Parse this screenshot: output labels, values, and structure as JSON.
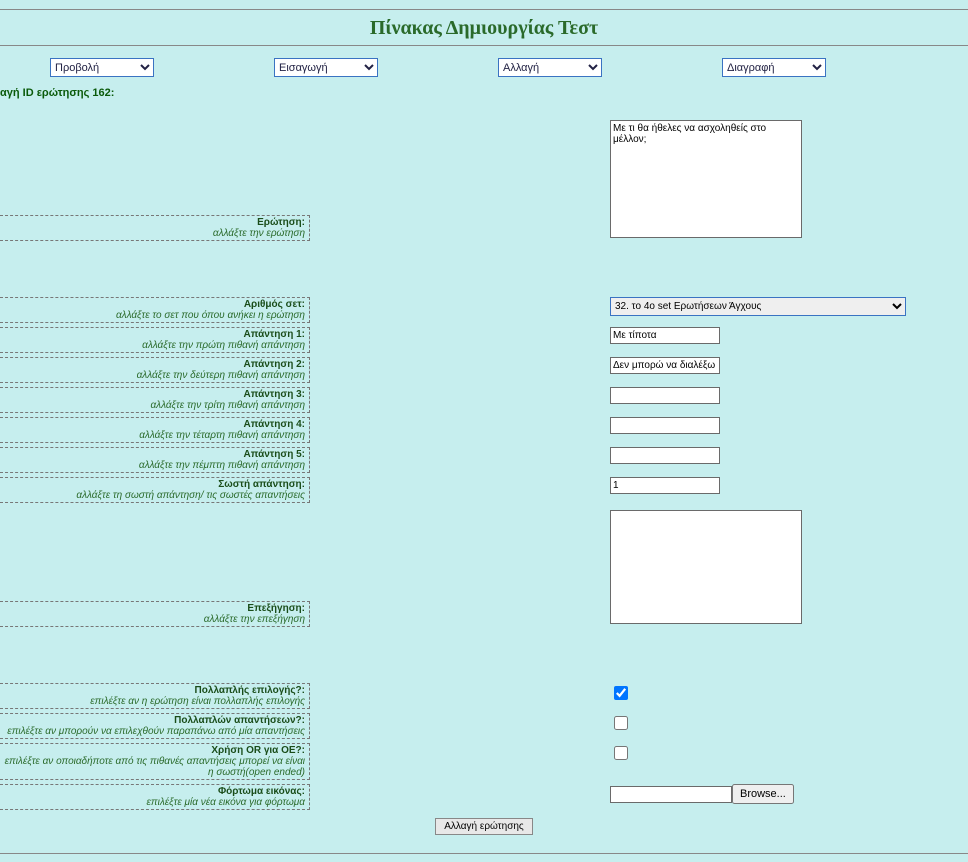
{
  "title": "Πίνακας Δημιουργίας Τεστ",
  "toolbar": {
    "view": "Προβολή",
    "insert": "Εισαγωγή",
    "change": "Αλλαγή",
    "delete": "Διαγραφή"
  },
  "status": "αγή ID ερώτησης 162:",
  "labels": {
    "question": "Ερώτηση:",
    "question_hint": "αλλάξτε την ερώτηση",
    "set_num": "Αριθμός σετ:",
    "set_num_hint": "αλλάξτε το σετ που όπου ανήκει η ερώτηση",
    "ans1": "Απάντηση 1:",
    "ans1_hint": "αλλάξτε την πρώτη πιθανή απάντηση",
    "ans2": "Απάντηση 2:",
    "ans2_hint": "αλλάξτε την δεύτερη πιθανή απάντηση",
    "ans3": "Απάντηση 3:",
    "ans3_hint": "αλλάξτε την τρίτη πιθανή απάντηση",
    "ans4": "Απάντηση 4:",
    "ans4_hint": "αλλάξτε την τέταρτη πιθανή απάντηση",
    "ans5": "Απάντηση 5:",
    "ans5_hint": "αλλάξτε την πέμπτη πιθανή απάντηση",
    "correct": "Σωστή απάντηση:",
    "correct_hint": "αλλάξτε τη σωστή απάντηση/ τις σωστές απαντήσεις",
    "explain": "Επεξήγηση:",
    "explain_hint": "αλλάξτε την επεξήγηση",
    "multi_choice": "Πολλαπλής επιλογής?:",
    "multi_choice_hint": "επιλέξτε αν η ερώτηση είναι πολλαπλής επιλογής",
    "multi_ans": "Πολλαπλών απαντήσεων?:",
    "multi_ans_hint": "επιλέξτε αν μπορούν να επιλεχθούν παραπάνω από μία απαντήσεις",
    "use_or": "Χρήση OR για ΟΕ?:",
    "use_or_hint": "επιλέξτε αν οποιαδήποτε από τις πιθανές απαντήσεις μπορεί να είναι η σωστή(open ended)",
    "upload": "Φόρτωμα εικόνας:",
    "upload_hint": "επιλέξτε μία νέα εικόνα για φόρτωμα"
  },
  "values": {
    "question": "Με τι θα ήθελες να ασχοληθείς στο μέλλον;",
    "set_option": "32. το 4ο set Ερωτήσεων Άγχους",
    "ans1": "Με τίποτα",
    "ans2": "Δεν μπορώ να διαλέξω",
    "ans3": "",
    "ans4": "",
    "ans5": "",
    "correct": "1",
    "explain": "",
    "file": ""
  },
  "buttons": {
    "browse": "Browse...",
    "submit": "Αλλαγή ερώτησης"
  },
  "footer": ""
}
